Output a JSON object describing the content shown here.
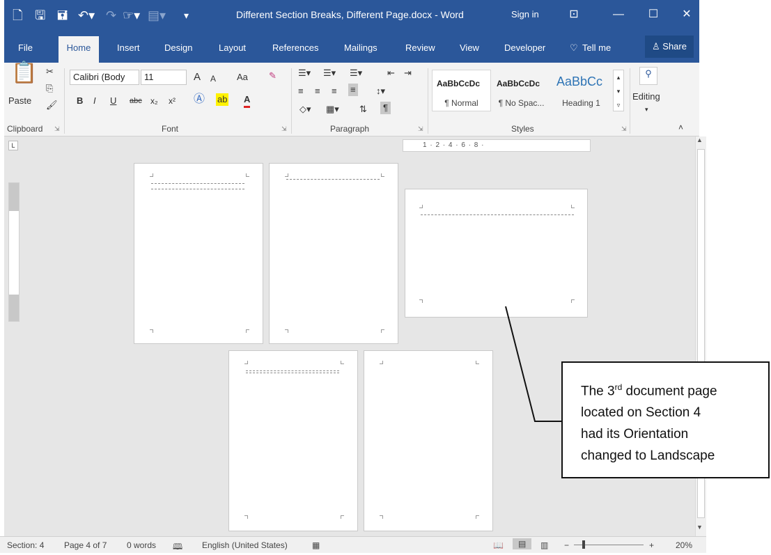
{
  "titlebar": {
    "doc_title": "Different Section Breaks, Different Page.docx - Word",
    "sign_in": "Sign in"
  },
  "tabs": [
    "File",
    "Home",
    "Insert",
    "Design",
    "Layout",
    "References",
    "Mailings",
    "Review",
    "View",
    "Developer",
    "Tell me",
    "Share"
  ],
  "clipboard": {
    "paste": "Paste",
    "label": "Clipboard"
  },
  "font": {
    "name": "Calibri (Body",
    "size": "11",
    "label": "Font",
    "bold": "B",
    "italic": "I",
    "underline": "U",
    "strike": "abc",
    "subscript": "x₂",
    "superscript": "x²",
    "grow": "A",
    "shrink": "A",
    "case": "Aa",
    "highlight": "ab",
    "color": "A"
  },
  "paragraph": {
    "label": "Paragraph"
  },
  "styles": {
    "label": "Styles",
    "items": [
      {
        "preview": "AaBbCcDc",
        "name": "¶ Normal"
      },
      {
        "preview": "AaBbCcDc",
        "name": "¶ No Spac..."
      },
      {
        "preview": "AaBbCc",
        "name": "Heading 1"
      }
    ]
  },
  "editing": {
    "label": "Editing"
  },
  "ruler": {
    "text": "1 · 2 · 4 · 6 · 8 ·"
  },
  "status": {
    "section": "Section: 4",
    "page": "Page 4 of 7",
    "words": "0 words",
    "language": "English (United States)",
    "zoom": "20%"
  },
  "callout": {
    "line1_pre": "The 3",
    "line1_sup": "rd",
    "line1_post": " document page",
    "line2": "located on Section 4",
    "line3": "had its Orientation",
    "line4": "changed to Landscape"
  }
}
